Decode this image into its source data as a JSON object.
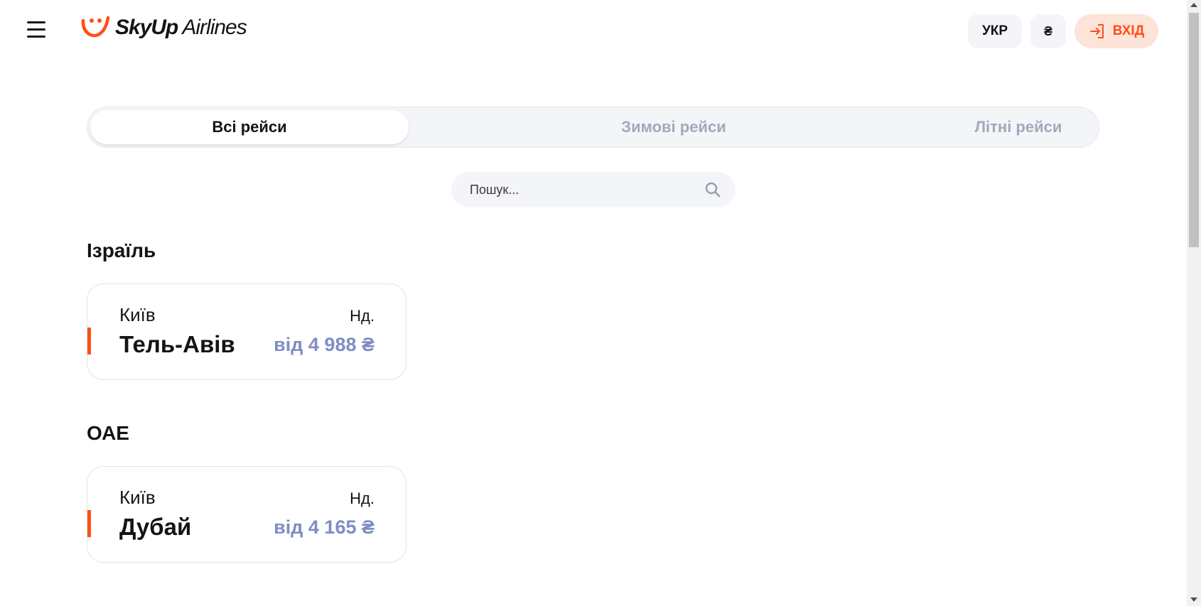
{
  "header": {
    "logo_brand": "SkyUp",
    "logo_suffix": "Airlines",
    "lang_label": "УКР",
    "currency_label": "₴",
    "login_label": "ВХІД"
  },
  "tabs": [
    {
      "label": "Всі рейси",
      "active": true
    },
    {
      "label": "Зимові рейси",
      "active": false
    },
    {
      "label": "Літні рейси",
      "active": false
    }
  ],
  "search": {
    "placeholder": "Пошук...",
    "value": ""
  },
  "sections": [
    {
      "country": "Ізраїль",
      "route": {
        "from": "Київ",
        "to": "Тель-Авів",
        "day": "Нд.",
        "price": "від 4 988 ₴"
      }
    },
    {
      "country": "ОАЕ",
      "route": {
        "from": "Київ",
        "to": "Дубай",
        "day": "Нд.",
        "price": "від 4 165 ₴"
      }
    }
  ],
  "colors": {
    "accent": "#ff4e17",
    "price": "#7f8dc3",
    "tab_bg": "#f4f5f9",
    "login_bg": "#fde3d8"
  },
  "icons": [
    "menu-icon",
    "skyup-logo-icon",
    "login-icon",
    "search-icon"
  ]
}
